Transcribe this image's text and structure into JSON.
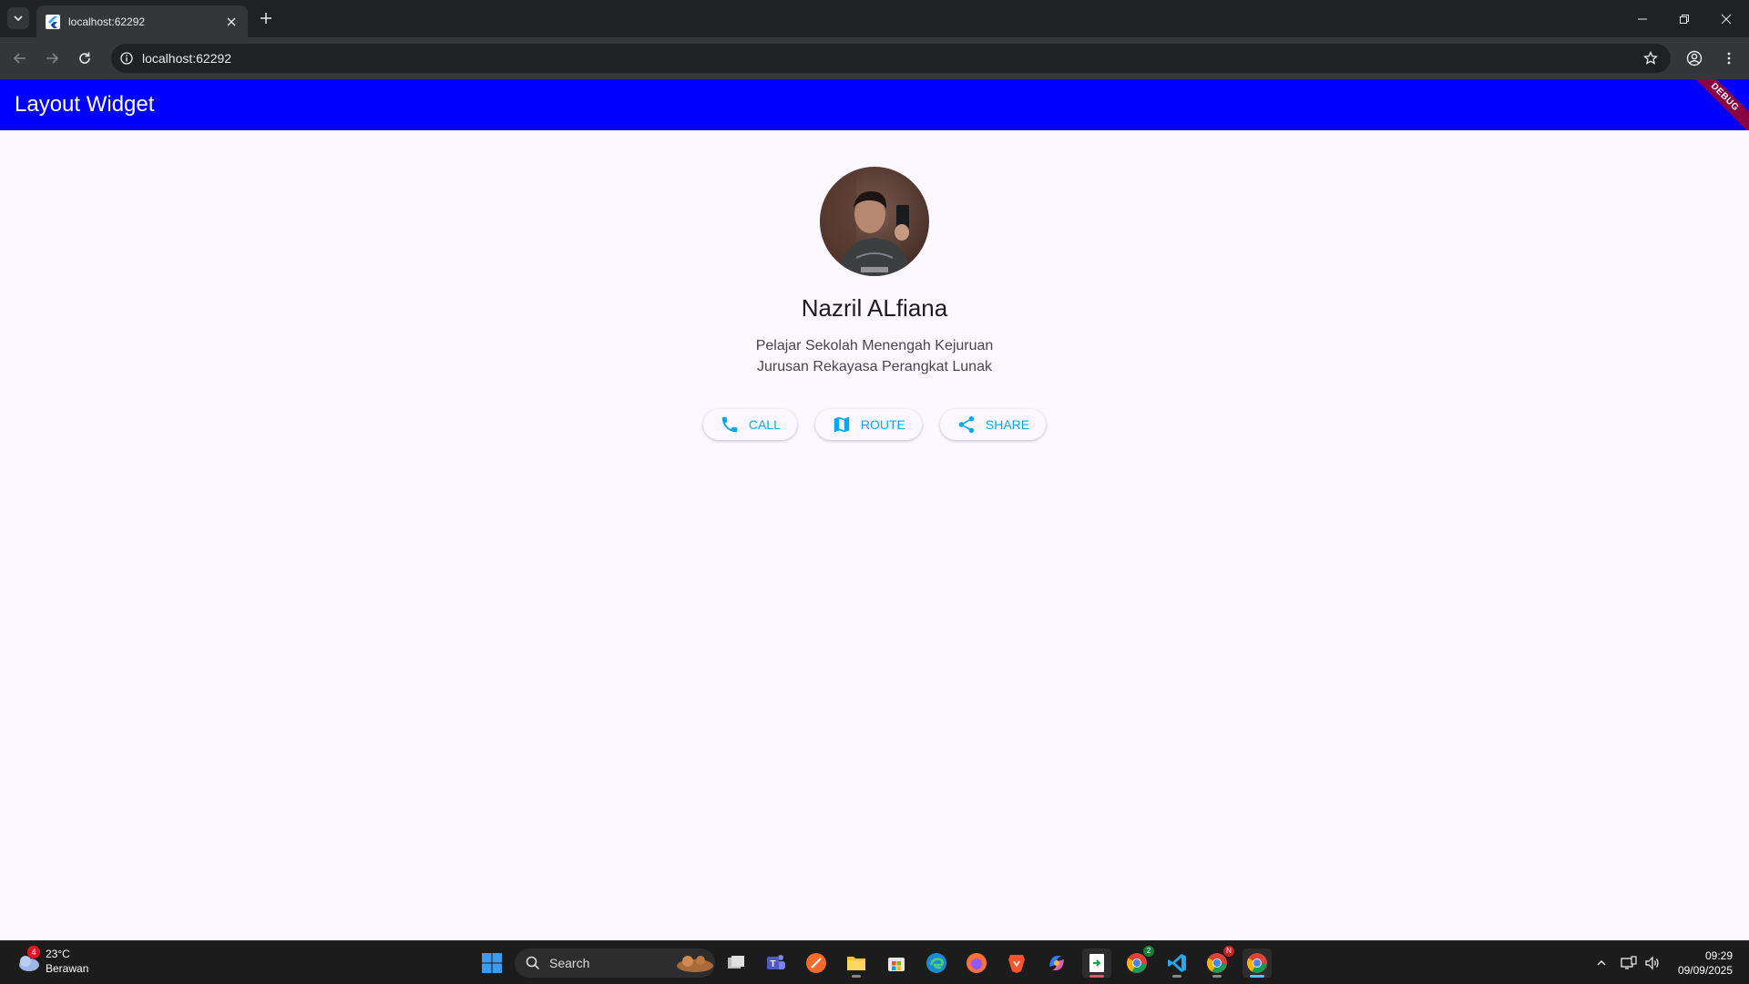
{
  "browser": {
    "tab_title": "localhost:62292",
    "url": "localhost:62292"
  },
  "app": {
    "title": "Layout Widget",
    "debug_label": "DEBUG",
    "bar_color": "#0000ff"
  },
  "profile": {
    "name": "Nazril ALfiana",
    "description_line1": "Pelajar Sekolah Menengah Kejuruan",
    "description_line2": "Jurusan Rekayasa Perangkat Lunak",
    "buttons": [
      {
        "label": "CALL",
        "icon": "phone-icon"
      },
      {
        "label": "ROUTE",
        "icon": "map-icon"
      },
      {
        "label": "SHARE",
        "icon": "share-icon"
      }
    ],
    "accent_color": "#03a9f4"
  },
  "taskbar": {
    "weather_temp": "23°C",
    "weather_desc": "Berawan",
    "weather_badge": "4",
    "search_label": "Search",
    "chrome_badge": "2",
    "chrome2_badge": "N",
    "time": "09:29",
    "date": "09/09/2025"
  }
}
